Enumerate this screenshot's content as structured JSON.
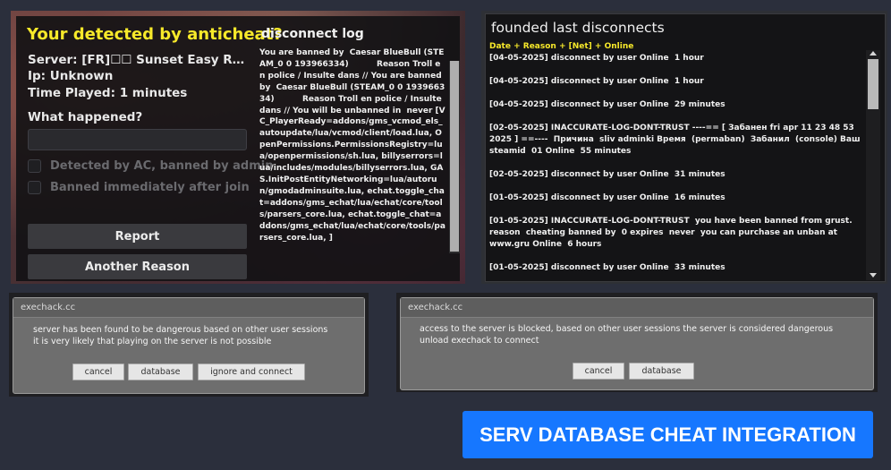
{
  "detection_panel": {
    "title": "Your detected by anticheat?",
    "server": "Server: [FR]☐☐ Sunset Easy RP ✨ L...",
    "ip": "Ip: Unknown",
    "time_played": "Time Played: 1 minutes",
    "what_happened_label": "What happened?",
    "what_happened_value": "",
    "option_detected": "Detected by AC, banned by admin",
    "option_banned": "Banned immediately after join",
    "report_button": "Report",
    "another_reason_button": "Another Reason",
    "log_title": "disconnect log",
    "log_text": "You are banned by  Caesar BlueBull (STEAM_0 0 193966334)          Reason Troll en police / Insulte dans // You are banned by  Caesar BlueBull (STEAM_0 0 193966334)          Reason Troll en police / Insulte dans // You will be unbanned in  never [VC_PlayerReady=addons/gms_vcmod_els_autoupdate/lua/vcmod/client/load.lua, OpenPermissions.PermissionsRegistry=lua/openpermissions/sh.lua, billyserrors=lua/includes/modules/billyserrors.lua, GAS.InitPostEntityNetworking=lua/autorun/gmodadminsuite.lua, echat.toggle_chat=addons/gms_echat/lua/echat/core/tools/parsers_core.lua, echat.toggle_chat=addons/gms_echat/lua/echat/core/tools/parsers_core.lua, ]"
  },
  "disconnects_panel": {
    "title": "founded last disconnects",
    "header": "Date + Reason + [Net] + Online",
    "entries": [
      "[04-05-2025] disconnect by user Online  1 hour",
      "[04-05-2025] disconnect by user Online  1 hour",
      "[04-05-2025] disconnect by user Online  29 minutes",
      "[02-05-2025] INACCURATE-LOG-DONT-TRUST ----== [ Забанен fri apr 11 23 48 53 2025 ] ==----  Причина  sliv adminki Время  (permaban)  Забанил  (console) Ваш steamid  01 Online  55 minutes",
      "[02-05-2025] disconnect by user Online  31 minutes",
      "[01-05-2025] disconnect by user Online  16 minutes",
      "[01-05-2025] INACCURATE-LOG-DONT-TRUST  you have been banned from grust. reason  cheating banned by  0 expires  never  you can purchase an unban at www.gru Online  6 hours",
      "[01-05-2025] disconnect by user Online  33 minutes"
    ]
  },
  "dialog_left": {
    "title": "exechack.cc",
    "message": "server has been found to be dangerous based on other user sessions\nit is very likely that playing on the server is not possible",
    "cancel": "cancel",
    "database": "database",
    "ignore": "ignore and connect"
  },
  "dialog_right": {
    "title": "exechack.cc",
    "message": "access to the server is blocked, based on other user sessions the server is considered dangerous\nunload exechack to connect",
    "cancel": "cancel",
    "database": "database"
  },
  "cta_button": "SERV DATABASE CHEAT INTEGRATION"
}
